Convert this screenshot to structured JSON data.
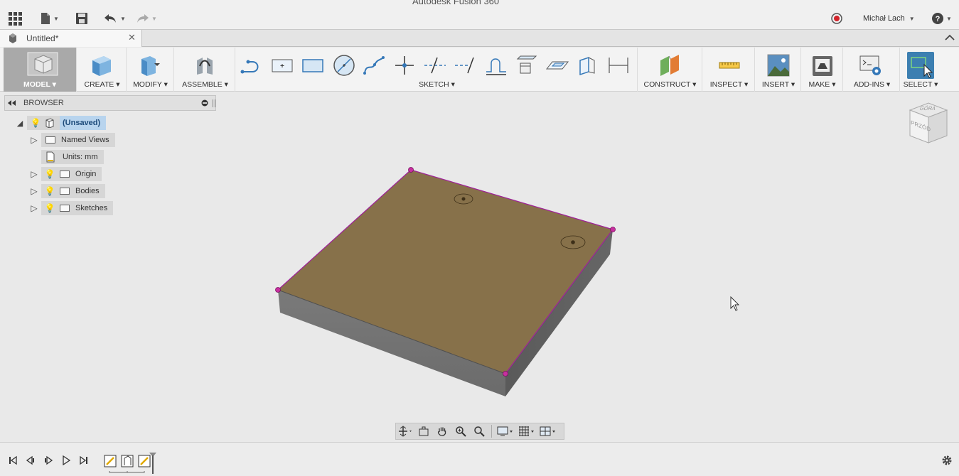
{
  "app_title": "Autodesk Fusion 360",
  "user": {
    "name": "Michał Lach"
  },
  "document_tab": {
    "title": "Untitled*",
    "close": "✕"
  },
  "toolbar": {
    "workspace": "MODEL",
    "create": "CREATE",
    "modify": "MODIFY",
    "assemble": "ASSEMBLE",
    "sketch": "SKETCH",
    "construct": "CONSTRUCT",
    "inspect": "INSPECT",
    "insert": "INSERT",
    "make": "MAKE",
    "addins": "ADD-INS",
    "select": "SELECT"
  },
  "browser": {
    "title": "BROWSER",
    "root": "(Unsaved)",
    "items": [
      "Named Views",
      "Units: mm",
      "Origin",
      "Bodies",
      "Sketches"
    ]
  },
  "viewcube": {
    "top": "GÓRA",
    "front": "PRZÓD"
  },
  "colors": {
    "accent": "#3c7fb1",
    "body_top": "#87714a",
    "body_side": "#727272",
    "edge_highlight": "#a0209a"
  }
}
